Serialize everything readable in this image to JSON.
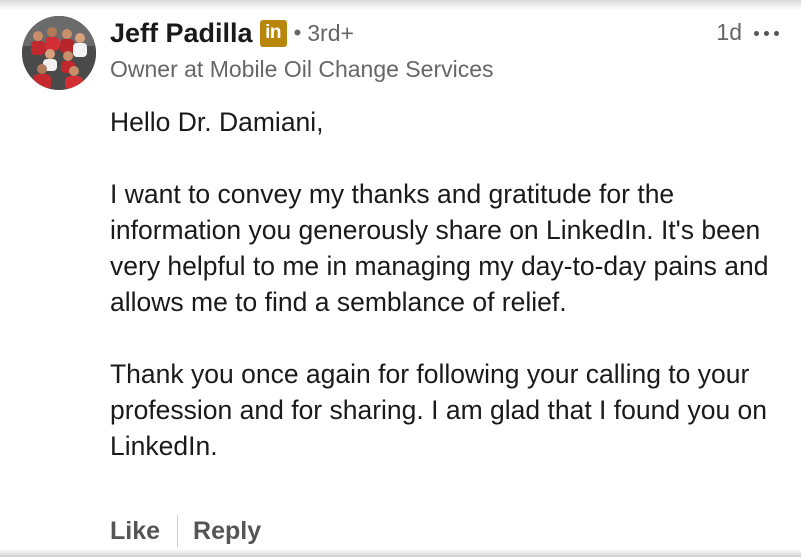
{
  "comment": {
    "author": {
      "name": "Jeff Padilla",
      "badge_text": "in",
      "separator": "•",
      "degree": "3rd+",
      "headline": "Owner at Mobile Oil Change Services"
    },
    "timestamp": "1d",
    "more_icon": "more-horizontal-icon",
    "body": {
      "greeting": "Hello Dr. Damiani,",
      "paragraph_1": "I want to convey my thanks and gratitude for the information you generously share on LinkedIn. It's been very helpful to me in managing my day-to-day pains and allows me to find a semblance of relief.",
      "paragraph_2": "Thank you once again for following your calling to your profession and for sharing. I am glad that I found you on LinkedIn."
    },
    "actions": {
      "like_label": "Like",
      "reply_label": "Reply"
    }
  },
  "colors": {
    "text_primary": "#1a1a1a",
    "text_secondary": "#666666",
    "badge_gold": "#b8860b"
  }
}
